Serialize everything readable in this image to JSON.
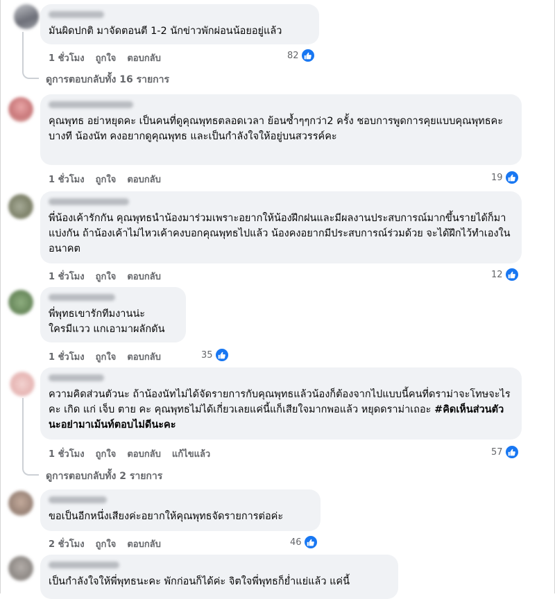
{
  "comments": [
    {
      "text": "มันผิดปกติ มาจัดตอนตี 1-2 นักข่าวพักผ่อนน้อยอยู่แล้ว",
      "time": "1 ชั่วโมง",
      "like": "ถูกใจ",
      "reply": "ตอบกลับ",
      "reactions": "82",
      "avatar_color": "#6d6f78"
    },
    {
      "text": "คุณพุทธ อย่าหยุดคะ เป็นคนที่ดูคุณพุทธตลอดเวลา ย้อนซ้ำๆๆกว่า2 ครั้ง ชอบการพูดการคุยแบบคุณพุทธคะ\nบางที น้องนัท คงอยากดูคุณพุทธ และเป็นกำลังใจให้อยู่บนสวรรค์คะ",
      "time": "1 ชั่วโมง",
      "like": "ถูกใจ",
      "reply": "ตอบกลับ",
      "reactions": "19",
      "avatar_color": "#c9787a"
    },
    {
      "text": "พี่น้องเค้ารักกัน คุณพุทธนำน้องมาร่วมเพราะอยากให้น้องฝึกฝนและมีผลงานประสบการณ์มากขึ้นรายได้ก็มาแบ่งกัน ถ้าน้องเค้าไม่ไหวเค้าคงบอกคุณพุทธไปแล้ว น้องคงอยากมีประสบการณ์ร่วมด้วย จะได้ฝึกไว้ทำเองในอนาคต",
      "time": "1 ชั่วโมง",
      "like": "ถูกใจ",
      "reply": "ตอบกลับ",
      "reactions": "12",
      "avatar_color": "#7d8169"
    },
    {
      "text": "พี่พุทธเขารักทีมงานน่ะ\nใครมีแวว แกเอามาผลักดัน",
      "time": "1 ชั่วโมง",
      "like": "ถูกใจ",
      "reply": "ตอบกลับ",
      "reactions": "35",
      "avatar_color": "#6a8a5d"
    },
    {
      "text_plain": "ความคิดส่วนตัวนะ ถ้าน้องนัทไม่ได้จัดรายการกับคุณพุทธแล้วน้องก็ต้องจากไปแบบนี้คนที่ดราม่าจะโทษจะไรคะ เกิด แก่ เจ็บ ตาย คะ คุณพุทธไม่ได้เกี่ยวเลยแค่นี้แก็เสียใจมากพอแล้ว หยุดดราม่าเถอะ ",
      "hashtag": "#คิดเห็นส่วนตัวนะอย่ามาเม้นท์ตอบไม่ดีนะคะ",
      "time": "1 ชั่วโมง",
      "like": "ถูกใจ",
      "reply": "ตอบกลับ",
      "edited": "แก้ไขแล้ว",
      "reactions": "57",
      "avatar_color": "#e7b7b5"
    },
    {
      "text": "ขอเป็นอีกหนึ่งเสียงค่ะอยากให้คุณพุทธจัดรายการต่อค่ะ",
      "time": "2 ชั่วโมง",
      "like": "ถูกใจ",
      "reply": "ตอบกลับ",
      "reactions": "46",
      "avatar_color": "#9a8478"
    },
    {
      "text": "เป็นกำลังใจให้พี่พุทธนะคะ พักก่อนก็ได้ค่ะ จิตใจพี่พุทธก็ย่ำแย่แล้ว แค่นี้",
      "avatar_color": "#8f8a86"
    }
  ],
  "more_replies": [
    "ดูการตอบกลับทั้ง 16 รายการ",
    "ดูการตอบกลับทั้ง 2 รายการ"
  ],
  "icons": {
    "like": "thumbs-up-icon"
  },
  "colors": {
    "like_blue": "#1877f2",
    "bubble": "#f0f2f5",
    "meta": "#65676b"
  }
}
